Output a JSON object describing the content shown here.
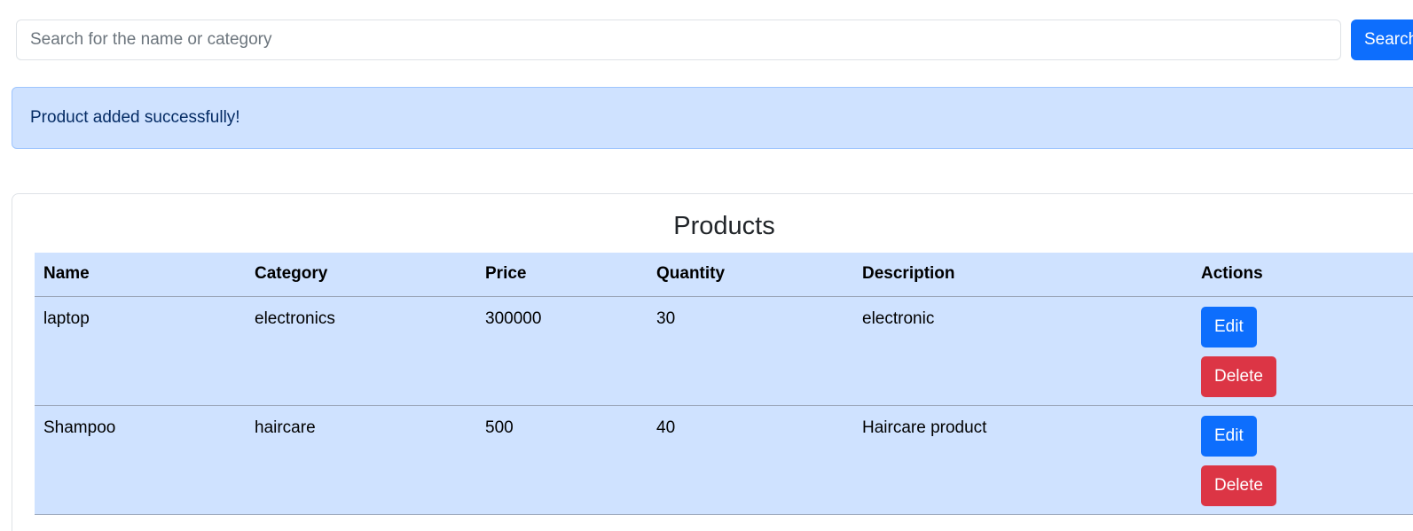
{
  "search": {
    "placeholder": "Search for the name or category",
    "value": "",
    "button_label": "Search"
  },
  "alert": {
    "message": "Product added successfully!"
  },
  "products": {
    "title": "Products",
    "columns": [
      "Name",
      "Category",
      "Price",
      "Quantity",
      "Description",
      "Actions"
    ],
    "rows": [
      {
        "name": "laptop",
        "category": "electronics",
        "price": "300000",
        "quantity": "30",
        "description": "electronic",
        "edit_label": "Edit",
        "delete_label": "Delete"
      },
      {
        "name": "Shampoo",
        "category": "haircare",
        "price": "500",
        "quantity": "40",
        "description": "Haircare product",
        "edit_label": "Edit",
        "delete_label": "Delete"
      }
    ]
  },
  "colors": {
    "primary": "#0d6efd",
    "danger": "#dc3545",
    "info_bg": "#cfe2ff",
    "info_text": "#052c65"
  }
}
